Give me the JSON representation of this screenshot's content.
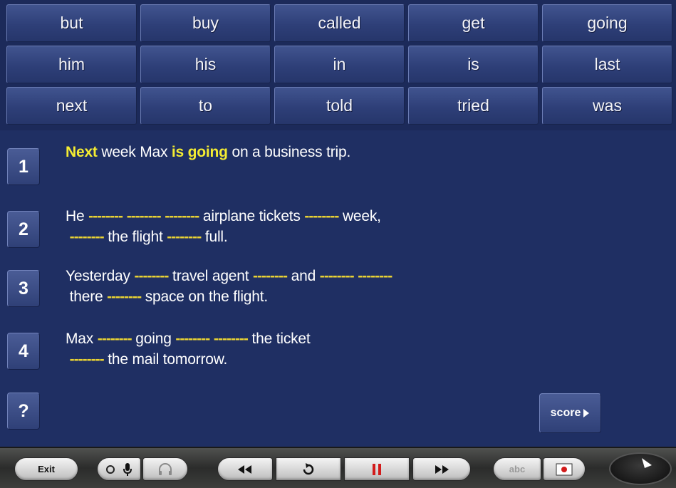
{
  "word_bank": {
    "rows": [
      [
        "but",
        "buy",
        "called",
        "get",
        "going"
      ],
      [
        "him",
        "his",
        "in",
        "is",
        "last"
      ],
      [
        "next",
        "to",
        "told",
        "tried",
        "was"
      ]
    ]
  },
  "exercise": {
    "items": [
      {
        "number": "1",
        "lines": [
          [
            {
              "t": "Next",
              "k": "hl"
            },
            {
              "t": " week Max ",
              "k": "text"
            },
            {
              "t": "is going",
              "k": "hl"
            },
            {
              "t": " on a business trip.",
              "k": "text"
            }
          ]
        ]
      },
      {
        "number": "2",
        "lines": [
          [
            {
              "t": "He ",
              "k": "text"
            },
            {
              "t": "--------",
              "k": "blank"
            },
            {
              "t": " ",
              "k": "text"
            },
            {
              "t": "--------",
              "k": "blank"
            },
            {
              "t": " ",
              "k": "text"
            },
            {
              "t": "--------",
              "k": "blank"
            },
            {
              "t": " airplane tickets ",
              "k": "text"
            },
            {
              "t": "--------",
              "k": "blank"
            },
            {
              "t": " week,",
              "k": "text"
            }
          ],
          [
            {
              "t": " ",
              "k": "text"
            },
            {
              "t": "--------",
              "k": "blank"
            },
            {
              "t": " the flight ",
              "k": "text"
            },
            {
              "t": "--------",
              "k": "blank"
            },
            {
              "t": " full.",
              "k": "text"
            }
          ]
        ]
      },
      {
        "number": "3",
        "lines": [
          [
            {
              "t": "Yesterday ",
              "k": "text"
            },
            {
              "t": "--------",
              "k": "blank"
            },
            {
              "t": " travel agent ",
              "k": "text"
            },
            {
              "t": "--------",
              "k": "blank"
            },
            {
              "t": " and ",
              "k": "text"
            },
            {
              "t": "--------",
              "k": "blank"
            },
            {
              "t": " ",
              "k": "text"
            },
            {
              "t": "--------",
              "k": "blank"
            }
          ],
          [
            {
              "t": " there ",
              "k": "text"
            },
            {
              "t": "--------",
              "k": "blank"
            },
            {
              "t": " space on the flight.",
              "k": "text"
            }
          ]
        ]
      },
      {
        "number": "4",
        "lines": [
          [
            {
              "t": "Max ",
              "k": "text"
            },
            {
              "t": "--------",
              "k": "blank"
            },
            {
              "t": " going ",
              "k": "text"
            },
            {
              "t": "--------",
              "k": "blank"
            },
            {
              "t": " ",
              "k": "text"
            },
            {
              "t": "--------",
              "k": "blank"
            },
            {
              "t": " the ticket",
              "k": "text"
            }
          ],
          [
            {
              "t": " ",
              "k": "text"
            },
            {
              "t": "--------",
              "k": "blank"
            },
            {
              "t": " the mail tomorrow.",
              "k": "text"
            }
          ]
        ]
      }
    ],
    "help_label": "?",
    "score_label": "score"
  },
  "toolbar": {
    "exit_label": "Exit",
    "abc_label": "abc",
    "icons": {
      "mic": "microphone-icon",
      "headphones": "headphones-icon",
      "rewind": "rewind-icon",
      "repeat": "repeat-icon",
      "pause": "pause-icon",
      "forward": "fast-forward-icon",
      "record": "record-icon",
      "dial": "dial-icon"
    }
  },
  "colors": {
    "background": "#1f2f63",
    "highlight": "#f4ec32",
    "blank": "#e8d234",
    "pause_red": "#d21b1b"
  }
}
